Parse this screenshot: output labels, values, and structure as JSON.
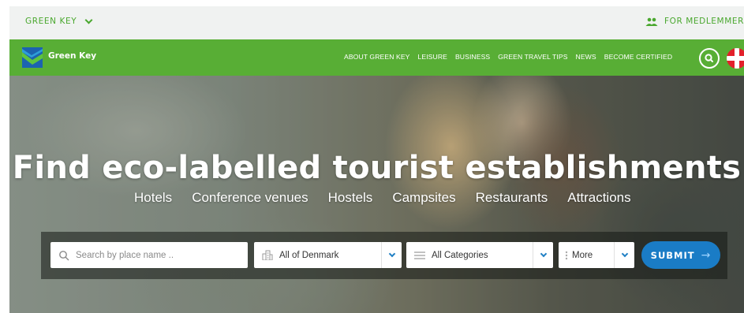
{
  "topbar": {
    "brand_label": "GREEN KEY",
    "members_label": "FOR MEDLEMMER",
    "icons": {
      "dropdown": "chevron-down-icon",
      "members": "people-icon"
    }
  },
  "nav": {
    "site_name": "Green Key",
    "menu": [
      "ABOUT GREEN KEY",
      "LEISURE",
      "BUSINESS",
      "GREEN TRAVEL TIPS",
      "NEWS",
      "BECOME CERTIFIED"
    ],
    "icons": {
      "search": "search-icon",
      "language": "denmark-flag-icon"
    }
  },
  "hero": {
    "headline": "Find eco-labelled tourist establishments",
    "categories": [
      "Hotels",
      "Conference venues",
      "Hostels",
      "Campsites",
      "Restaurants",
      "Attractions"
    ]
  },
  "search": {
    "place_placeholder": "Search by place name ..",
    "region_value": "All of Denmark",
    "category_value": "All Categories",
    "more_value": "More",
    "submit_label": "SUBMIT",
    "icons": {
      "search": "search-icon",
      "region": "buildings-icon",
      "category": "list-icon",
      "more": "dots-icon"
    }
  },
  "colors": {
    "brand_green": "#58ae35",
    "topbar_bg": "#f0f2f1",
    "submit_blue": "#1a7cc6",
    "logo_blue": "#1c63b0"
  }
}
